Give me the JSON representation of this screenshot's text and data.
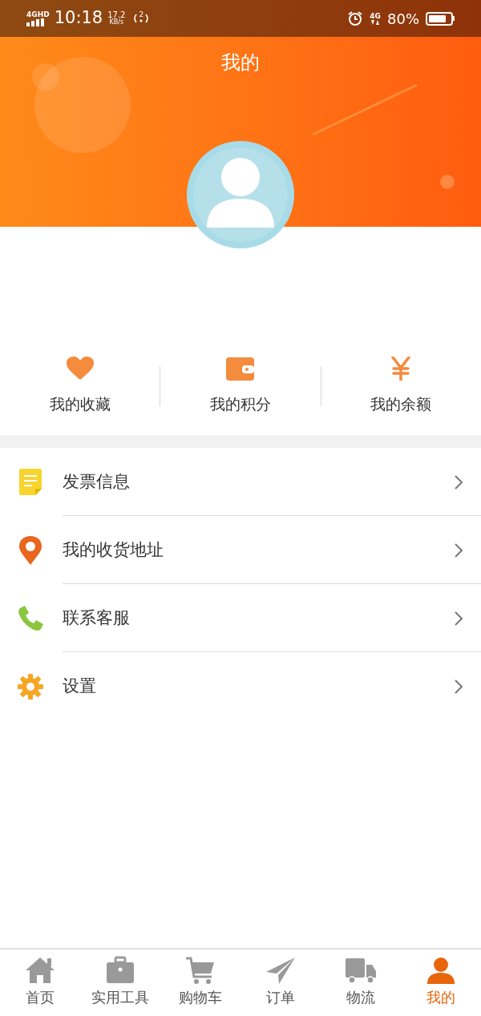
{
  "status_bar": {
    "network": "4GHD",
    "time": "10:18",
    "speed": "17.2",
    "speed_unit": "KB/s",
    "hotspot": "2",
    "data_network": "4G",
    "battery": "80%"
  },
  "header": {
    "title": "我的"
  },
  "stats": [
    {
      "kind": "heart",
      "label": "我的收藏"
    },
    {
      "kind": "wallet",
      "label": "我的积分"
    },
    {
      "kind": "yen",
      "label": "我的余额"
    }
  ],
  "menu": [
    {
      "kind": "invoice",
      "label": "发票信息"
    },
    {
      "kind": "location",
      "label": "我的收货地址"
    },
    {
      "kind": "phone",
      "label": "联系客服"
    },
    {
      "kind": "gear",
      "label": "设置"
    }
  ],
  "tabs": [
    {
      "kind": "home",
      "label": "首页",
      "selected": false
    },
    {
      "kind": "toolbox",
      "label": "实用工具",
      "selected": false
    },
    {
      "kind": "cart",
      "label": "购物车",
      "selected": false
    },
    {
      "kind": "plane",
      "label": "订单",
      "selected": false
    },
    {
      "kind": "truck",
      "label": "物流",
      "selected": false
    },
    {
      "kind": "person",
      "label": "我的",
      "selected": true
    }
  ]
}
